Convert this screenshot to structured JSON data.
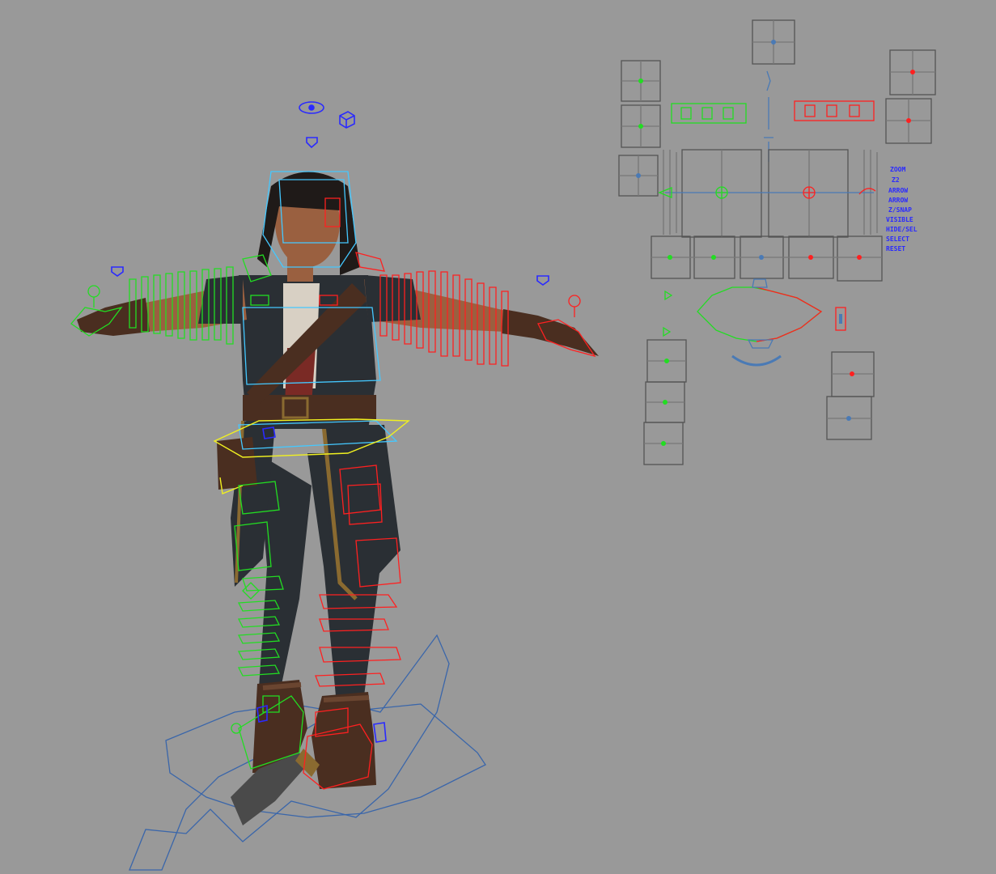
{
  "viewport": {
    "background": "#999999",
    "character": "rigged pirate character in T-pose"
  },
  "colors": {
    "left_side": "#22dd22",
    "right_side": "#ff2020",
    "center": "#2a2aff",
    "body_ctl": "#44c8ff",
    "hip_ctl": "#f0f020",
    "panel_line": "#555555",
    "root": "#3a66aa",
    "skin": "#9a6040",
    "cloth_dark": "#2a2f34",
    "trim_gold": "#8a6a30",
    "leather": "#4a2e20"
  },
  "picker_panel": {
    "labels": [
      "ZOOM",
      "Z2",
      "ARROW",
      "ARROW",
      "Z/SNAP",
      "VISIBLE",
      "HIDE/SEL",
      "SELECT",
      "RESET"
    ]
  },
  "icons": {
    "eye_icon": "eye-icon",
    "cube_icon": "cube-icon",
    "heart_icon": "heart-icon"
  }
}
